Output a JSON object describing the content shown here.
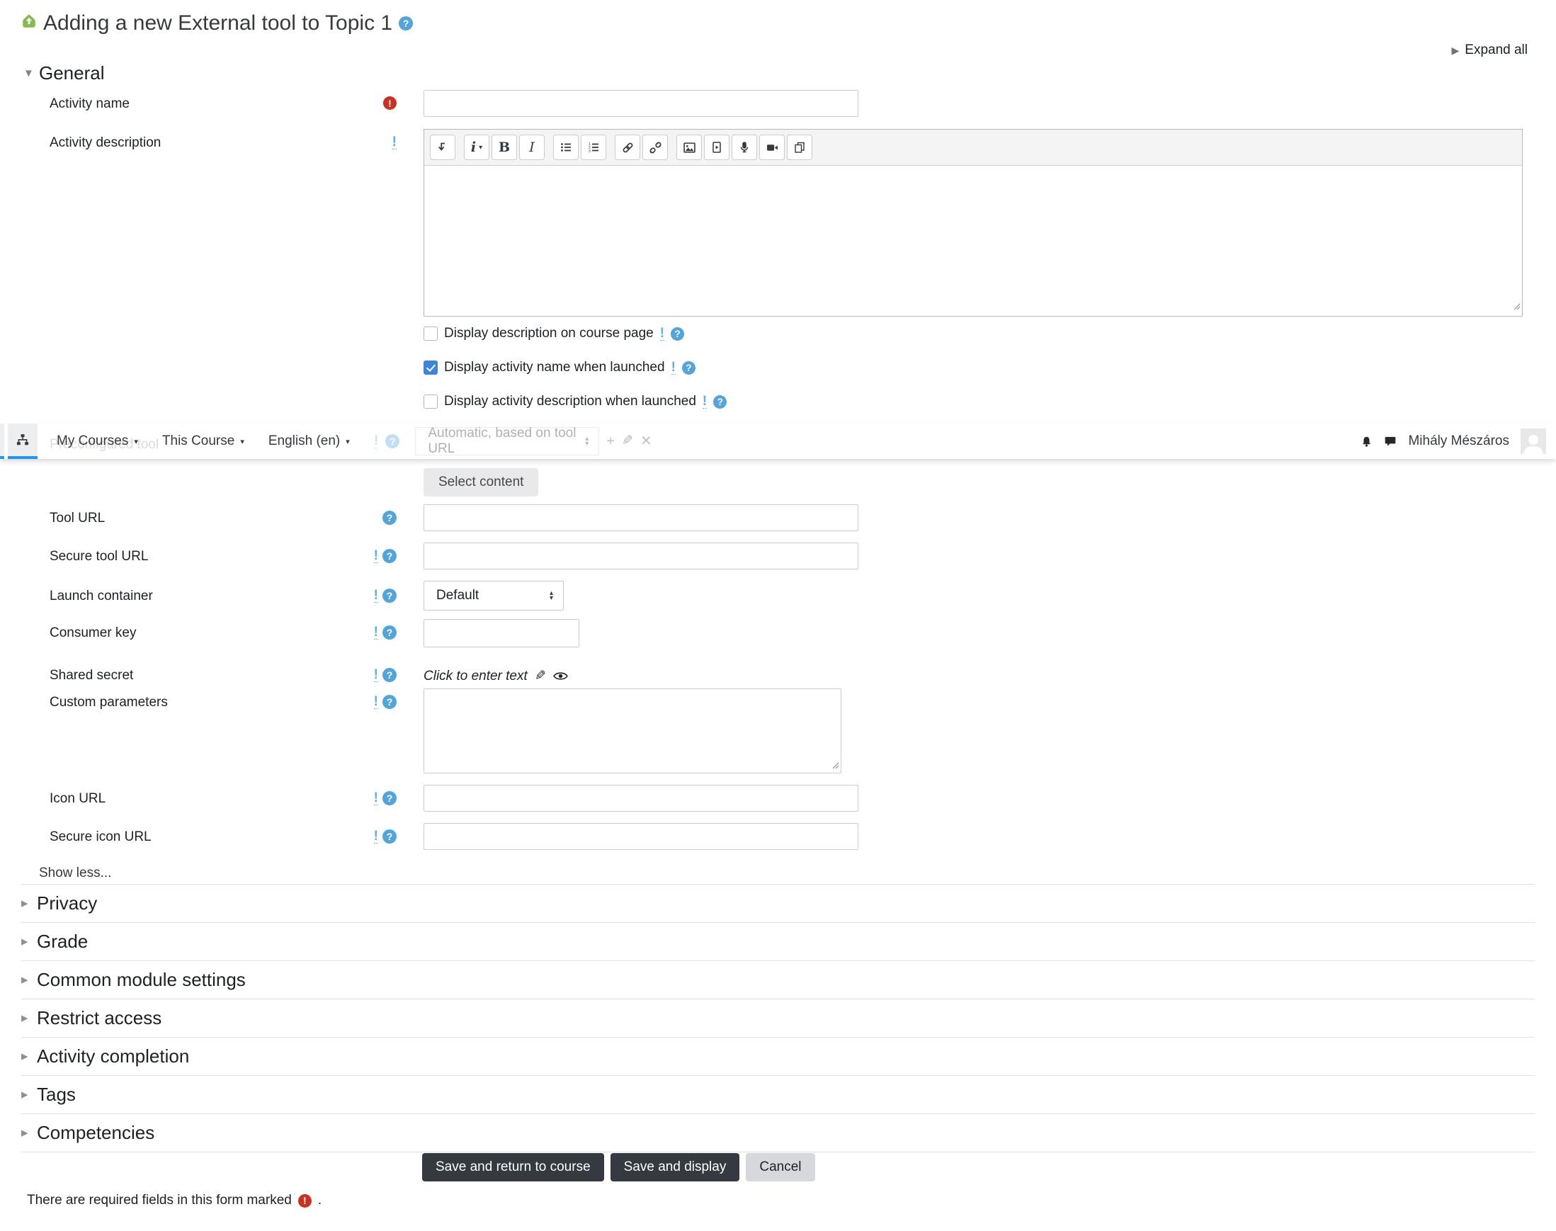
{
  "page": {
    "title": "Adding a new External tool to Topic 1",
    "expand_all": "Expand all",
    "show_less_label": "Show less...",
    "required_note": "There are required fields in this form marked",
    "required_note_period": "."
  },
  "navbar": {
    "menu_items": [
      {
        "label": "My Courses"
      },
      {
        "label": "This Course"
      },
      {
        "label": "English (en)"
      }
    ],
    "user_name": "Mihály Mészáros",
    "icons": [
      "sitemap-icon",
      "bell-icon",
      "messages-icon",
      "avatar"
    ],
    "active_tab_color": "#2096f3"
  },
  "general_section": {
    "title": "General"
  },
  "form": {
    "activity_name": {
      "label": "Activity name",
      "value": "",
      "required": true
    },
    "activity_description": {
      "label": "Activity description",
      "value": ""
    },
    "checkboxes": [
      {
        "label": "Display description on course page",
        "checked": false
      },
      {
        "label": "Display activity name when launched",
        "checked": true
      },
      {
        "label": "Display activity description when launched",
        "checked": false
      }
    ],
    "preconfigured_tool": {
      "label": "Preconfigured tool",
      "value": "Automatic, based on tool URL"
    },
    "select_content": {
      "label": "Select content"
    },
    "tool_url": {
      "label": "Tool URL",
      "value": ""
    },
    "secure_tool_url": {
      "label": "Secure tool URL",
      "value": ""
    },
    "launch_container": {
      "label": "Launch container",
      "value": "Default"
    },
    "consumer_key": {
      "label": "Consumer key",
      "value": ""
    },
    "shared_secret": {
      "label": "Shared secret",
      "placeholder": "Click to enter text"
    },
    "custom_parameters": {
      "label": "Custom parameters",
      "value": ""
    },
    "icon_url": {
      "label": "Icon URL",
      "value": ""
    },
    "secure_icon_url": {
      "label": "Secure icon URL",
      "value": ""
    }
  },
  "editor": {
    "toolbar_icons": [
      "collapse-toolbar-icon",
      "paragraph-styles-icon",
      "bold-icon",
      "italic-icon",
      "unordered-list-icon",
      "ordered-list-icon",
      "link-icon",
      "unlink-icon",
      "image-icon",
      "media-icon",
      "record-audio-icon",
      "record-video-icon",
      "manage-files-icon"
    ]
  },
  "collapsed_sections": [
    {
      "label": "Privacy"
    },
    {
      "label": "Grade"
    },
    {
      "label": "Common module settings"
    },
    {
      "label": "Restrict access"
    },
    {
      "label": "Activity completion"
    },
    {
      "label": "Tags"
    },
    {
      "label": "Competencies"
    }
  ],
  "footer": {
    "buttons": [
      {
        "label": "Save and return to course",
        "style": "dark"
      },
      {
        "label": "Save and display",
        "style": "dark"
      },
      {
        "label": "Cancel",
        "style": "light"
      }
    ]
  },
  "colors": {
    "help_icon_blue": "#52a5db",
    "required_red": "#ca3120",
    "checkbox_checked": "#3b86d8",
    "button_dark": "#343a40",
    "external_tool_green": "#84bb4c",
    "navbar_active_blue": "#2096f3"
  }
}
